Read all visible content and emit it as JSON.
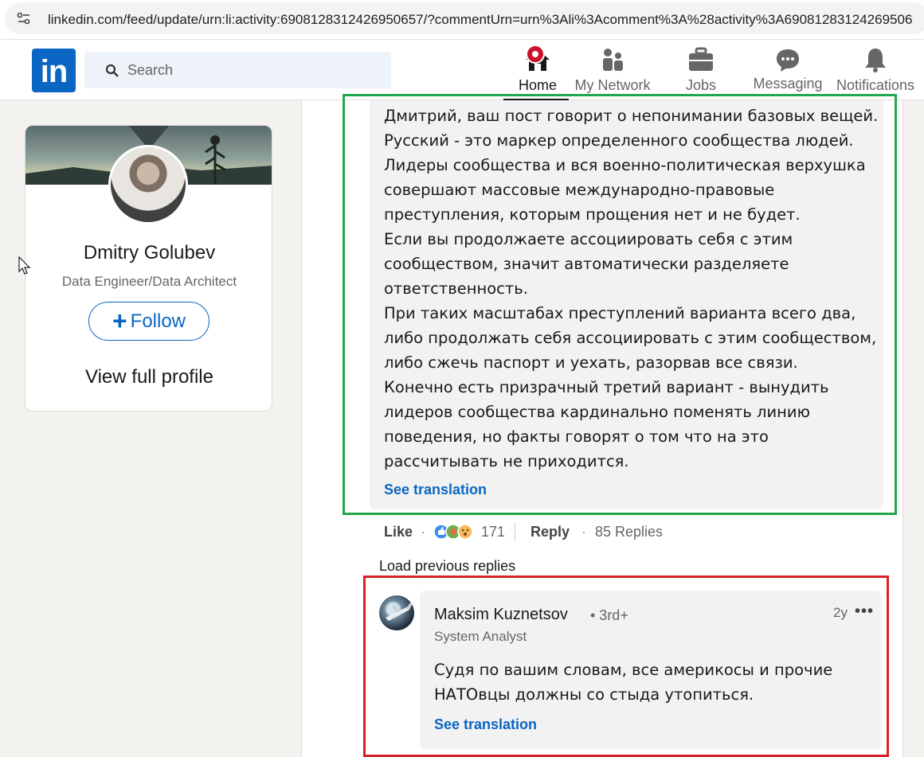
{
  "browser": {
    "url": "linkedin.com/feed/update/urn:li:activity:6908128312426950657/?commentUrn=urn%3Ali%3Acomment%3A%28activity%3A69081283124269506"
  },
  "nav": {
    "logo": "in",
    "search_placeholder": "Search",
    "items": [
      {
        "label": "Home",
        "icon": "home-icon"
      },
      {
        "label": "My Network",
        "icon": "people-icon"
      },
      {
        "label": "Jobs",
        "icon": "briefcase-icon"
      },
      {
        "label": "Messaging",
        "icon": "chat-icon"
      },
      {
        "label": "Notifications",
        "icon": "bell-icon"
      }
    ]
  },
  "profile": {
    "name": "Dmitry Golubev",
    "headline": "Data Engineer/Data Architect",
    "follow_label": "Follow",
    "view_profile_label": "View full profile"
  },
  "comment": {
    "lines": [
      "Дмитрий, ваш пост говорит о непонимании базовых вещей.",
      "Русский - это маркер определенного сообщества людей.",
      "Лидеры сообщества и вся военно-политическая верхушка",
      "совершают массовые международно-правовые",
      "преступления, которым прощения нет и не будет.",
      "Если вы продолжаете ассоциировать себя с этим",
      "сообществом, значит автоматически разделяете",
      "ответственность.",
      "При таких масштабах преступлений варианта всего два,",
      "либо продолжать себя ассоциировать с этим сообществом,",
      "либо сжечь паспорт и уехать, разорвав все связи.",
      "Конечно есть призрачный третий вариант - вынудить",
      "лидеров сообщества кардинально поменять линию",
      "поведения, но факты говорят о том что на это",
      "рассчитывать не приходится."
    ],
    "see_translation": "See translation",
    "like_label": "Like",
    "reaction_count": "171",
    "reply_label": "Reply",
    "replies_label": "85 Replies"
  },
  "load_previous": "Load previous replies",
  "reply": {
    "name": "Maksim Kuznetsov",
    "degree": "• 3rd+",
    "headline": "System Analyst",
    "time": "2y",
    "more": "•••",
    "lines": [
      "Судя по вашим словам, все америкосы и прочие",
      "НАТОвцы должны со стыда утопиться."
    ],
    "see_translation": "See translation"
  },
  "colors": {
    "brand": "#0a66c2",
    "highlight_green": "#1fa84b",
    "highlight_red": "#d8222a",
    "notification": "#cb112d"
  }
}
